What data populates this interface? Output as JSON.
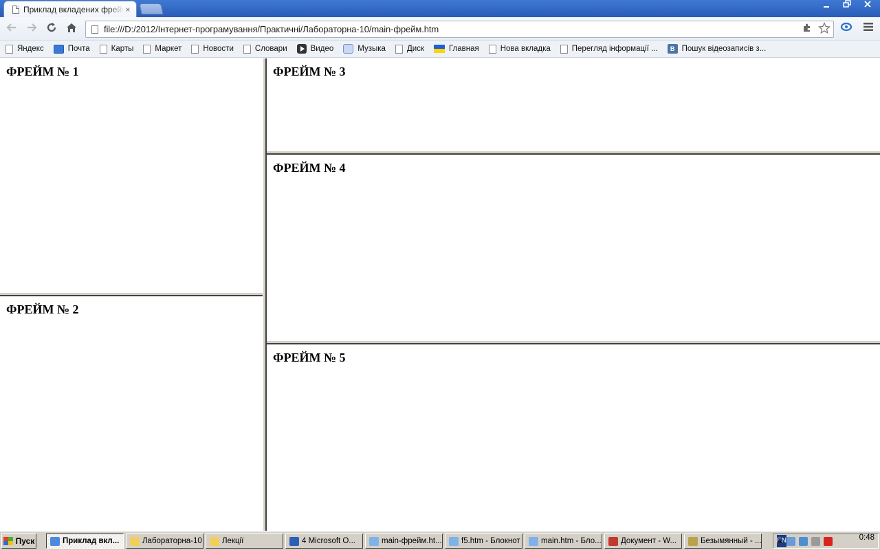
{
  "browser": {
    "tab_title": "Приклад вкладених фреймів",
    "tab_close": "×",
    "url": "file:///D:/2012/Інтернет-програмування/Практичні/Лабораторна-10/main-фрейм.htm",
    "window_controls": [
      "minimize",
      "restore",
      "close"
    ],
    "nav_icons": [
      "back-icon",
      "forward-icon",
      "reload-icon",
      "home-icon"
    ]
  },
  "bookmarks": [
    {
      "label": "Яндекс",
      "icon": "page"
    },
    {
      "label": "Почта",
      "icon": "mail"
    },
    {
      "label": "Карты",
      "icon": "page"
    },
    {
      "label": "Маркет",
      "icon": "page"
    },
    {
      "label": "Новости",
      "icon": "page"
    },
    {
      "label": "Словари",
      "icon": "page"
    },
    {
      "label": "Видео",
      "icon": "video"
    },
    {
      "label": "Музыка",
      "icon": "music"
    },
    {
      "label": "Диск",
      "icon": "page"
    },
    {
      "label": "Главная",
      "icon": "flag"
    },
    {
      "label": "Нова вкладка",
      "icon": "page"
    },
    {
      "label": "Перегляд інформації ...",
      "icon": "page"
    },
    {
      "label": "Пошук відеозаписів з...",
      "icon": "vk"
    }
  ],
  "frames": {
    "f1": "ФРЕЙМ № 1",
    "f2": "ФРЕЙМ № 2",
    "f3": "ФРЕЙМ № 3",
    "f4": "ФРЕЙМ № 4",
    "f5": "ФРЕЙМ № 5"
  },
  "taskbar": {
    "start": "Пуск",
    "tasks": [
      {
        "label": "Приклад вкл...",
        "icon_color": "#4a8be0",
        "active": true
      },
      {
        "label": "Лабораторна-10",
        "icon_color": "#f2cf5b",
        "active": false
      },
      {
        "label": "Лекції",
        "icon_color": "#f2cf5b",
        "active": false
      },
      {
        "label": "4 Microsoft O...",
        "icon_color": "#2b5fb4",
        "active": false
      },
      {
        "label": "main-фрейм.ht...",
        "icon_color": "#7fb2e8",
        "active": false
      },
      {
        "label": "f5.htm - Блокнот",
        "icon_color": "#7fb2e8",
        "active": false
      },
      {
        "label": "main.htm - Бло...",
        "icon_color": "#7fb2e8",
        "active": false
      },
      {
        "label": "Документ - W...",
        "icon_color": "#c23a2b",
        "active": false
      },
      {
        "label": "Безымянный - ...",
        "icon_color": "#b9a24a",
        "active": false
      }
    ],
    "lang": "EN",
    "tray_collapse": "«",
    "clock": "0:48"
  }
}
